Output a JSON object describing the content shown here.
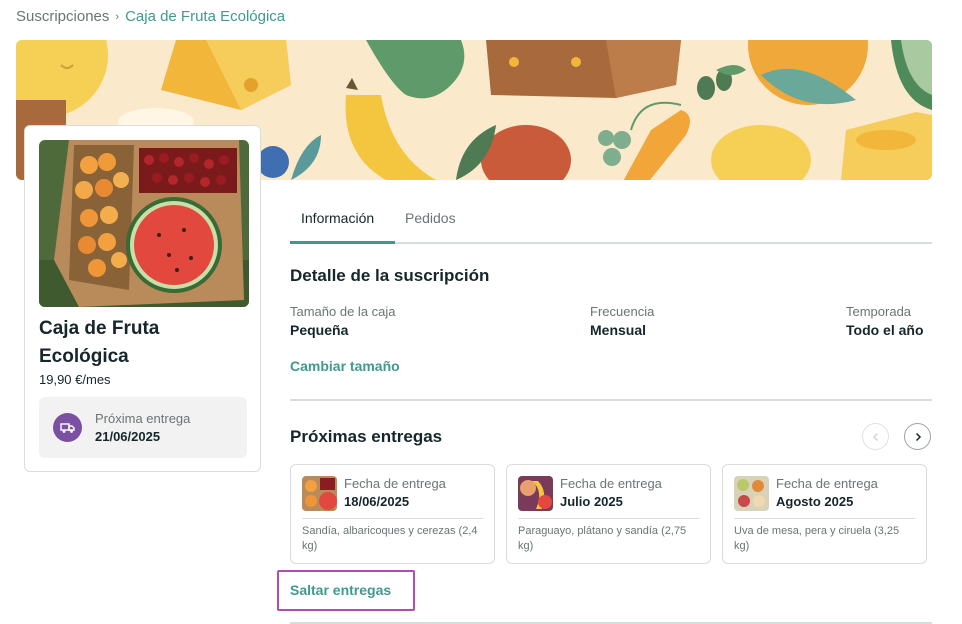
{
  "breadcrumb": {
    "root": "Suscripciones",
    "separator": "›",
    "current": "Caja de Fruta Ecológica"
  },
  "product": {
    "title": "Caja de Fruta Ecológica",
    "price": "19,90 €/mes",
    "next_delivery_label": "Próxima entrega",
    "next_delivery_date": "21/06/2025",
    "next_delivery_icon": "truck-icon"
  },
  "tabs": [
    {
      "label": "Información",
      "active": true
    },
    {
      "label": "Pedidos",
      "active": false
    }
  ],
  "details": {
    "title": "Detalle de la suscripción",
    "fields": [
      {
        "label": "Tamaño de la caja",
        "value": "Pequeña"
      },
      {
        "label": "Frecuencia",
        "value": "Mensual"
      },
      {
        "label": "Temporada",
        "value": "Todo el año"
      }
    ],
    "change_size_link": "Cambiar tamaño"
  },
  "upcoming": {
    "title": "Próximas entregas",
    "prev_icon": "chevron-left-icon",
    "next_icon": "chevron-right-icon",
    "deliveries": [
      {
        "label": "Fecha de entrega",
        "date": "18/06/2025",
        "description": "Sandía, albaricoques y cerezas (2,4 kg)"
      },
      {
        "label": "Fecha de entrega",
        "date": "Julio 2025",
        "description": "Paraguayo, plátano y sandía (2,75 kg)"
      },
      {
        "label": "Fecha de entrega",
        "date": "Agosto 2025",
        "description": "Uva de mesa, pera y ciruela (3,25 kg)"
      }
    ],
    "skip_link": "Saltar entregas"
  },
  "colors": {
    "accent": "#3f9a8e",
    "truck_badge": "#7b4fa2",
    "highlight_border": "#b04db0",
    "banner_bg": "#fbe9cc"
  }
}
